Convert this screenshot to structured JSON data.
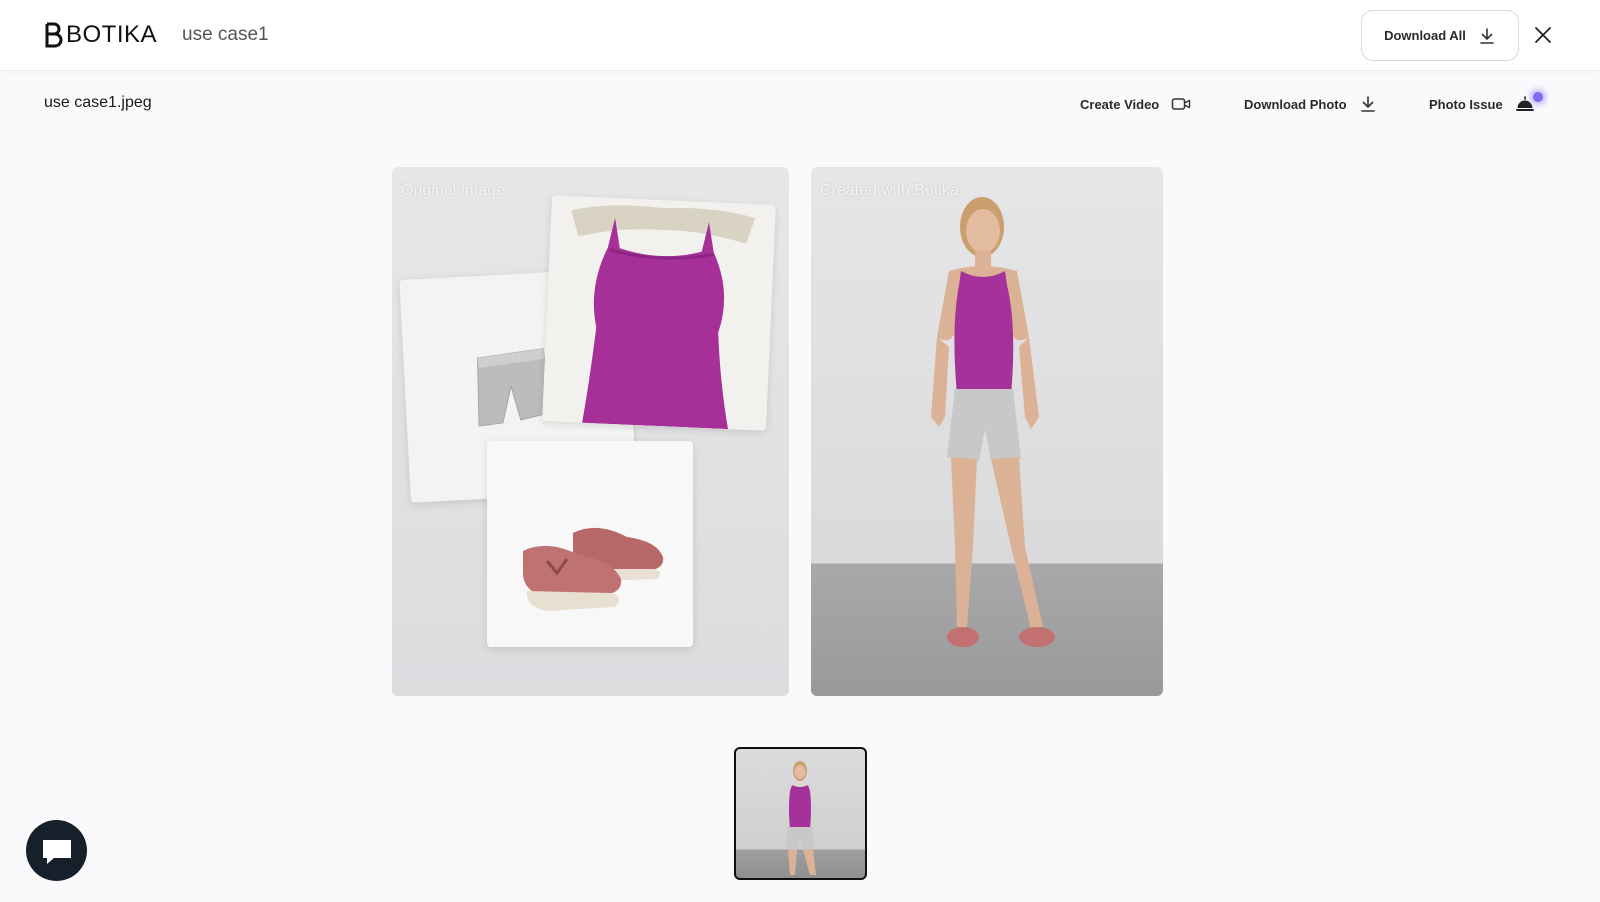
{
  "header": {
    "logo_text": "BOTIKA",
    "project_name": "use case1",
    "download_all_label": "Download All"
  },
  "toolbar": {
    "filename": "use case1.jpeg",
    "create_video_label": "Create Video",
    "download_photo_label": "Download Photo",
    "photo_issue_label": "Photo Issue"
  },
  "panels": {
    "original_label": "Original Image",
    "created_label": "Created with Botika"
  },
  "icons": {
    "download": "download-icon",
    "close": "close-icon",
    "video": "video-camera-icon",
    "photo_issue": "service-bell-icon",
    "chat": "chat-icon"
  },
  "colors": {
    "notification_dot": "#7b6cf0",
    "top_magenta": "#a8329a",
    "shoes": "#b86a6a",
    "chat_button": "#15202b"
  }
}
